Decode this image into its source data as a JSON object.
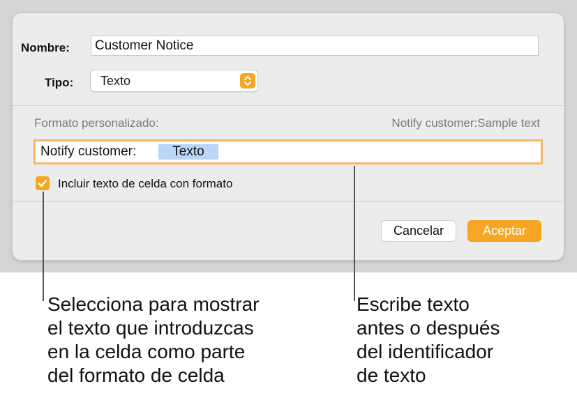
{
  "dialog": {
    "name_label": "Nombre:",
    "name_value": "Customer Notice",
    "type_label": "Tipo:",
    "type_value": "Texto",
    "custom_format_label": "Formato personalizado:",
    "preview": "Notify customer:Sample text",
    "format_prefix": "Notify customer:",
    "format_token": "Texto",
    "checkbox_label": "Incluir texto de celda con formato",
    "checkbox_checked": true,
    "cancel_label": "Cancelar",
    "accept_label": "Aceptar"
  },
  "callouts": {
    "left": [
      "Selecciona para mostrar",
      "el texto que introduzcas",
      "en la celda como parte",
      "del formato de celda"
    ],
    "right": [
      "Escribe texto",
      "antes o después",
      "del identificador",
      "de texto"
    ]
  },
  "colors": {
    "accent": "#f6a623",
    "focus_ring": "#f7b566",
    "token_bg": "#b9d5f7"
  },
  "icons": {
    "popup": "chevron-up-down-icon",
    "checkbox": "checkmark-icon"
  }
}
